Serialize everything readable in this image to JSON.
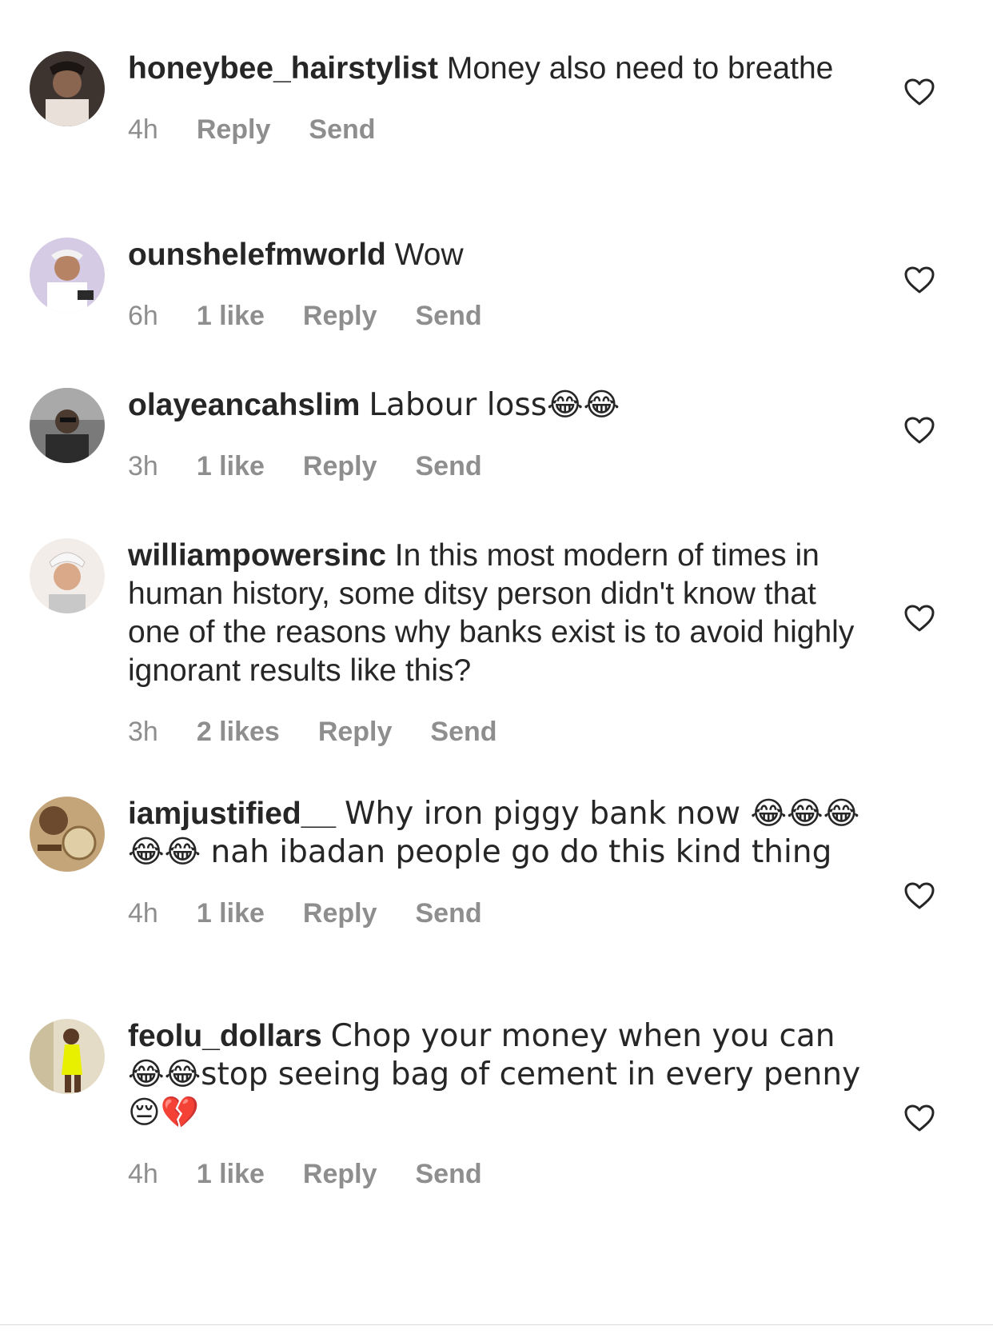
{
  "comments": [
    {
      "username": "honeybee_hairstylist",
      "text": "Money also need to breathe",
      "time": "4h",
      "likes": "",
      "reply_label": "Reply",
      "send_label": "Send",
      "avatar_color": "#5a4a42"
    },
    {
      "username": "ounshelefmworld",
      "text": "Wow",
      "time": "6h",
      "likes": "1 like",
      "reply_label": "Reply",
      "send_label": "Send",
      "avatar_color": "#c7b8d8"
    },
    {
      "username": "olayeancahslim",
      "text": "Labour loss😂😂",
      "time": "3h",
      "likes": "1 like",
      "reply_label": "Reply",
      "send_label": "Send",
      "avatar_color": "#6b6b6b"
    },
    {
      "username": "williampowersinc",
      "text": "In this most modern of times in human history, some ditsy person didn't know that one of the reasons why banks exist is to avoid highly ignorant results like this?",
      "time": "3h",
      "likes": "2 likes",
      "reply_label": "Reply",
      "send_label": "Send",
      "avatar_color": "#e6c9b5"
    },
    {
      "username": "iamjustified__",
      "text": "Why iron piggy bank now 😂😂😂😂😂 nah ibadan people go do this kind thing",
      "time": "4h",
      "likes": "1 like",
      "reply_label": "Reply",
      "send_label": "Send",
      "avatar_color": "#a98a5e"
    },
    {
      "username": "feolu_dollars",
      "text": "Chop your money when you can 😂😂stop seeing bag of cement in every penny 😔💔",
      "time": "4h",
      "likes": "1 like",
      "reply_label": "Reply",
      "send_label": "Send",
      "avatar_color": "#d7c9a4"
    }
  ],
  "colors": {
    "text": "#262626",
    "meta": "#8e8e8e",
    "background": "#ffffff"
  },
  "icons": {
    "like": "heart-outline-icon"
  }
}
